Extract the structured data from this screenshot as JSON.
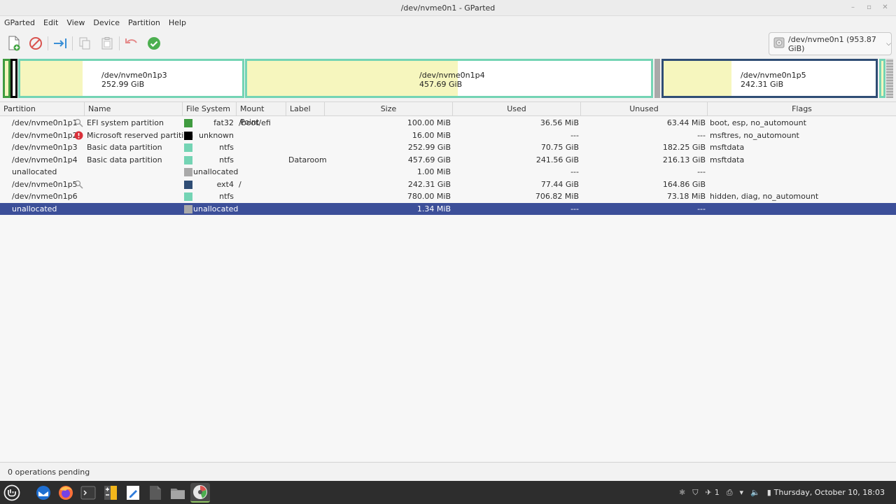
{
  "window": {
    "title": "/dev/nvme0n1 - GParted"
  },
  "menu": [
    "GParted",
    "Edit",
    "View",
    "Device",
    "Partition",
    "Help"
  ],
  "device_selector": {
    "label": "/dev/nvme0n1  (953.87 GiB)"
  },
  "diskmap": {
    "p3": {
      "name": "/dev/nvme0n1p3",
      "size": "252.99 GiB"
    },
    "p4": {
      "name": "/dev/nvme0n1p4",
      "size": "457.69 GiB"
    },
    "p5": {
      "name": "/dev/nvme0n1p5",
      "size": "242.31 GiB"
    }
  },
  "columns": [
    "Partition",
    "Name",
    "File System",
    "Mount Point",
    "Label",
    "Size",
    "Used",
    "Unused",
    "Flags"
  ],
  "rows": [
    {
      "partition": "/dev/nvme0n1p1",
      "name": "EFI system partition",
      "fs": "fat32",
      "fs_color": "#3f9b3f",
      "mount": "/boot/efi",
      "label": "",
      "size": "100.00 MiB",
      "used": "36.56 MiB",
      "unused": "63.44 MiB",
      "flags": "boot, esp, no_automount",
      "icon": "search"
    },
    {
      "partition": "/dev/nvme0n1p2",
      "name": "Microsoft reserved partition",
      "fs": "unknown",
      "fs_color": "#000000",
      "mount": "",
      "label": "",
      "size": "16.00 MiB",
      "used": "---",
      "unused": "---",
      "flags": "msftres, no_automount",
      "icon": "warning"
    },
    {
      "partition": "/dev/nvme0n1p3",
      "name": "Basic data partition",
      "fs": "ntfs",
      "fs_color": "#74d4b4",
      "mount": "",
      "label": "",
      "size": "252.99 GiB",
      "used": "70.75 GiB",
      "unused": "182.25 GiB",
      "flags": "msftdata",
      "icon": ""
    },
    {
      "partition": "/dev/nvme0n1p4",
      "name": "Basic data partition",
      "fs": "ntfs",
      "fs_color": "#74d4b4",
      "mount": "",
      "label": "Dataroom",
      "size": "457.69 GiB",
      "used": "241.56 GiB",
      "unused": "216.13 GiB",
      "flags": "msftdata",
      "icon": ""
    },
    {
      "partition": "unallocated",
      "name": "",
      "fs": "unallocated",
      "fs_color": "#a9a9a9",
      "mount": "",
      "label": "",
      "size": "1.00 MiB",
      "used": "---",
      "unused": "---",
      "flags": "",
      "icon": ""
    },
    {
      "partition": "/dev/nvme0n1p5",
      "name": "",
      "fs": "ext4",
      "fs_color": "#2f4d75",
      "mount": "/",
      "label": "",
      "size": "242.31 GiB",
      "used": "77.44 GiB",
      "unused": "164.86 GiB",
      "flags": "",
      "icon": "search"
    },
    {
      "partition": "/dev/nvme0n1p6",
      "name": "",
      "fs": "ntfs",
      "fs_color": "#74d4b4",
      "mount": "",
      "label": "",
      "size": "780.00 MiB",
      "used": "706.82 MiB",
      "unused": "73.18 MiB",
      "flags": "hidden, diag, no_automount",
      "icon": ""
    },
    {
      "partition": "unallocated",
      "name": "",
      "fs": "unallocated",
      "fs_color": "#a9a9a9",
      "mount": "",
      "label": "",
      "size": "1.34 MiB",
      "used": "---",
      "unused": "---",
      "flags": "",
      "icon": ""
    }
  ],
  "selected_row": 7,
  "status": {
    "text": "0 operations pending"
  },
  "taskbar": {
    "clock": "Thursday, October 10, 18:03",
    "notif_count": "1"
  },
  "colors": {
    "accent_selection": "#3c4f99",
    "used_space": "#f6f6be",
    "ntfs": "#74d4b4",
    "ext4": "#2f4d75",
    "fat32": "#3f9b3f"
  }
}
